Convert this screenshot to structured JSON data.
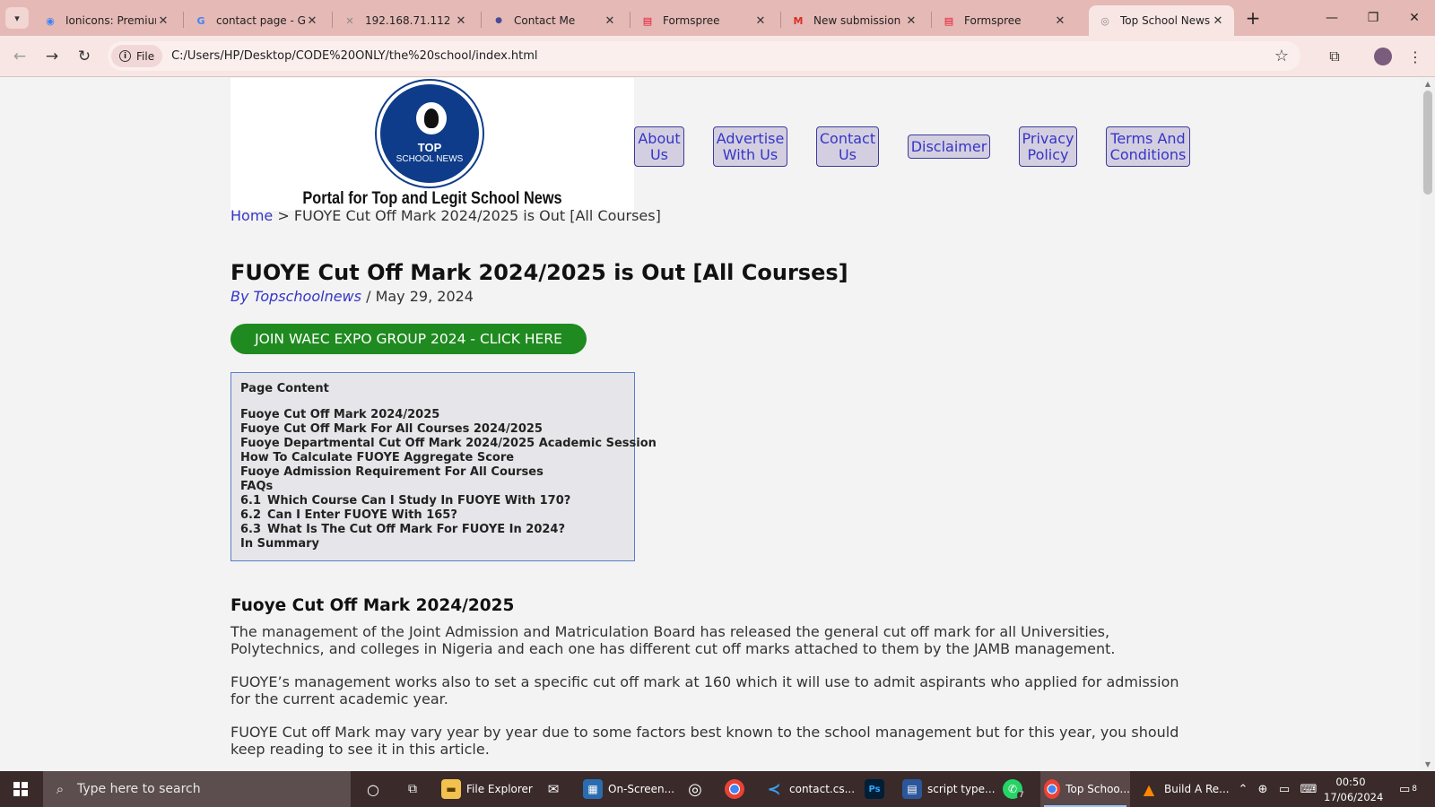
{
  "browser": {
    "tabs": [
      {
        "title": "Ionicons: Premium",
        "icon": "ionicons-favicon-icon"
      },
      {
        "title": "contact page - Go",
        "icon": "google-favicon-icon"
      },
      {
        "title": "192.168.71.112",
        "icon": "x-favicon-icon"
      },
      {
        "title": "Contact Me",
        "icon": "pageforge-favicon-icon"
      },
      {
        "title": "Formspree",
        "icon": "formspree-favicon-icon"
      },
      {
        "title": "New submission f",
        "icon": "gmail-favicon-icon"
      },
      {
        "title": "Formspree",
        "icon": "formspree-favicon-icon"
      },
      {
        "title": "Top School News",
        "icon": "globe-favicon-icon",
        "active": true
      }
    ],
    "address_chip": "File",
    "url": "C:/Users/HP/Desktop/CODE%20ONLY/the%20school/index.html"
  },
  "site": {
    "logo_line1": "TOP",
    "logo_line2": "SCHOOL NEWS",
    "tagline": "Portal for Top and Legit School News",
    "menu": [
      "About Us",
      "Advertise With Us",
      "Contact Us",
      "Disclaimer",
      "Privacy Policy",
      "Terms And Conditions"
    ]
  },
  "breadcrumb": {
    "home": "Home",
    "separator": ">",
    "current": "FUOYE Cut Off Mark 2024/2025 is Out [All Courses]"
  },
  "article": {
    "title": "FUOYE Cut Off Mark 2024/2025 is Out [All Courses]",
    "author": "By Topschoolnews",
    "date_sep": "/",
    "date": "May 29, 2024",
    "cta": "JOIN WAEC EXPO GROUP 2024 - CLICK HERE",
    "toc": {
      "heading": "Page Content",
      "items": [
        {
          "num": "",
          "text": "Fuoye Cut Off Mark 2024/2025"
        },
        {
          "num": "",
          "text": "Fuoye Cut Off Mark For All Courses 2024/2025"
        },
        {
          "num": "",
          "text": "Fuoye Departmental Cut Off Mark 2024/2025 Academic Session"
        },
        {
          "num": "",
          "text": "How To Calculate FUOYE Aggregate Score"
        },
        {
          "num": "",
          "text": "Fuoye Admission Requirement For All Courses"
        },
        {
          "num": "",
          "text": "FAQs"
        },
        {
          "num": "6.1",
          "text": "Which Course Can I Study In FUOYE With 170?"
        },
        {
          "num": "6.2",
          "text": "Can I Enter FUOYE With 165?"
        },
        {
          "num": "6.3",
          "text": "What Is The Cut Off Mark For FUOYE In 2024?"
        },
        {
          "num": "",
          "text": "In Summary"
        }
      ]
    },
    "section_heading": "Fuoye Cut Off Mark 2024/2025",
    "paragraphs": [
      "The management of the Joint Admission and Matriculation Board has released the general cut off mark for all Universities, Polytechnics, and colleges in Nigeria and each one has different cut off marks attached to them by the JAMB management.",
      "FUOYE’s management works also to set a specific cut off mark at 160 which it will use to admit aspirants who applied for admission for the current academic year.",
      "FUOYE Cut off Mark may vary year by year due to some factors best known to the school management but for this year, you should keep reading to see it in this article."
    ]
  },
  "taskbar": {
    "search_placeholder": "Type here to search",
    "apps": [
      {
        "label": "File Explorer"
      },
      {
        "label": ""
      },
      {
        "label": "On-Screen..."
      },
      {
        "label": ""
      },
      {
        "label": ""
      },
      {
        "label": "contact.cs..."
      },
      {
        "label": "Ps"
      },
      {
        "label": "script type..."
      },
      {
        "label": "7"
      },
      {
        "label": "Top Schoo..."
      },
      {
        "label": "Build A Re..."
      }
    ],
    "time": "00:50",
    "date": "17/06/2024",
    "notifications": "8"
  }
}
